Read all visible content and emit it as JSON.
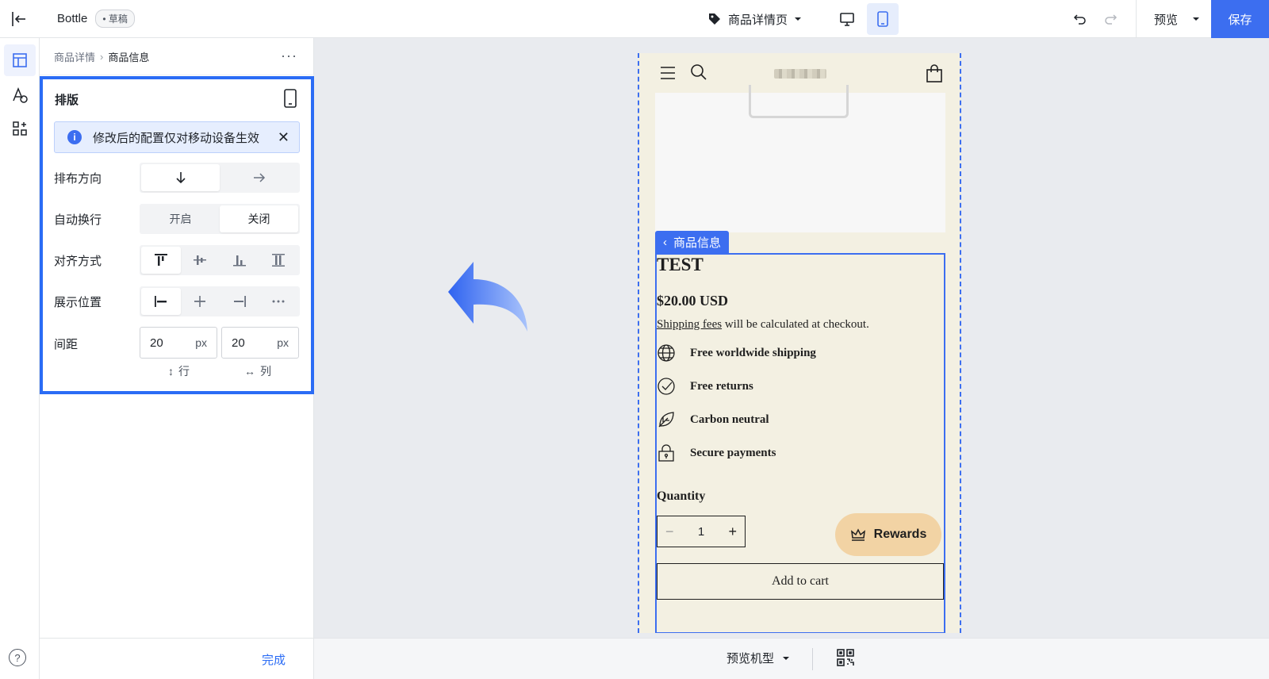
{
  "topbar": {
    "app_title": "Bottle",
    "draft_badge": "• 草稿",
    "page_select": "商品详情页",
    "preview": "预览",
    "save": "保存"
  },
  "panel": {
    "breadcrumb": [
      "商品详情",
      "商品信息"
    ],
    "section_title": "排版",
    "notice": "修改后的配置仅对移动设备生效",
    "rows": {
      "direction": "排布方向",
      "wrap": "自动换行",
      "wrap_on": "开启",
      "wrap_off": "关闭",
      "align": "对齐方式",
      "position": "展示位置",
      "gap": "间距"
    },
    "gap_row_value": "20",
    "gap_col_value": "20",
    "unit": "px",
    "gap_row_hint": "行",
    "gap_col_hint": "列",
    "done": "完成"
  },
  "bottom": {
    "model_select": "预览机型"
  },
  "phone": {
    "tag": "商品信息",
    "title": "TEST",
    "price": "$20.00 USD",
    "shipping_link": "Shipping fees",
    "shipping_rest": " will be calculated at checkout.",
    "features": [
      "Free worldwide shipping",
      "Free returns",
      "Carbon neutral",
      "Secure payments"
    ],
    "quantity_label": "Quantity",
    "quantity_value": "1",
    "rewards": "Rewards",
    "add_to_cart": "Add to cart"
  },
  "colors": {
    "accent": "#3c6ef0",
    "phone_bg": "#f3f0e2",
    "rewards_bg": "#f2d3a4"
  }
}
